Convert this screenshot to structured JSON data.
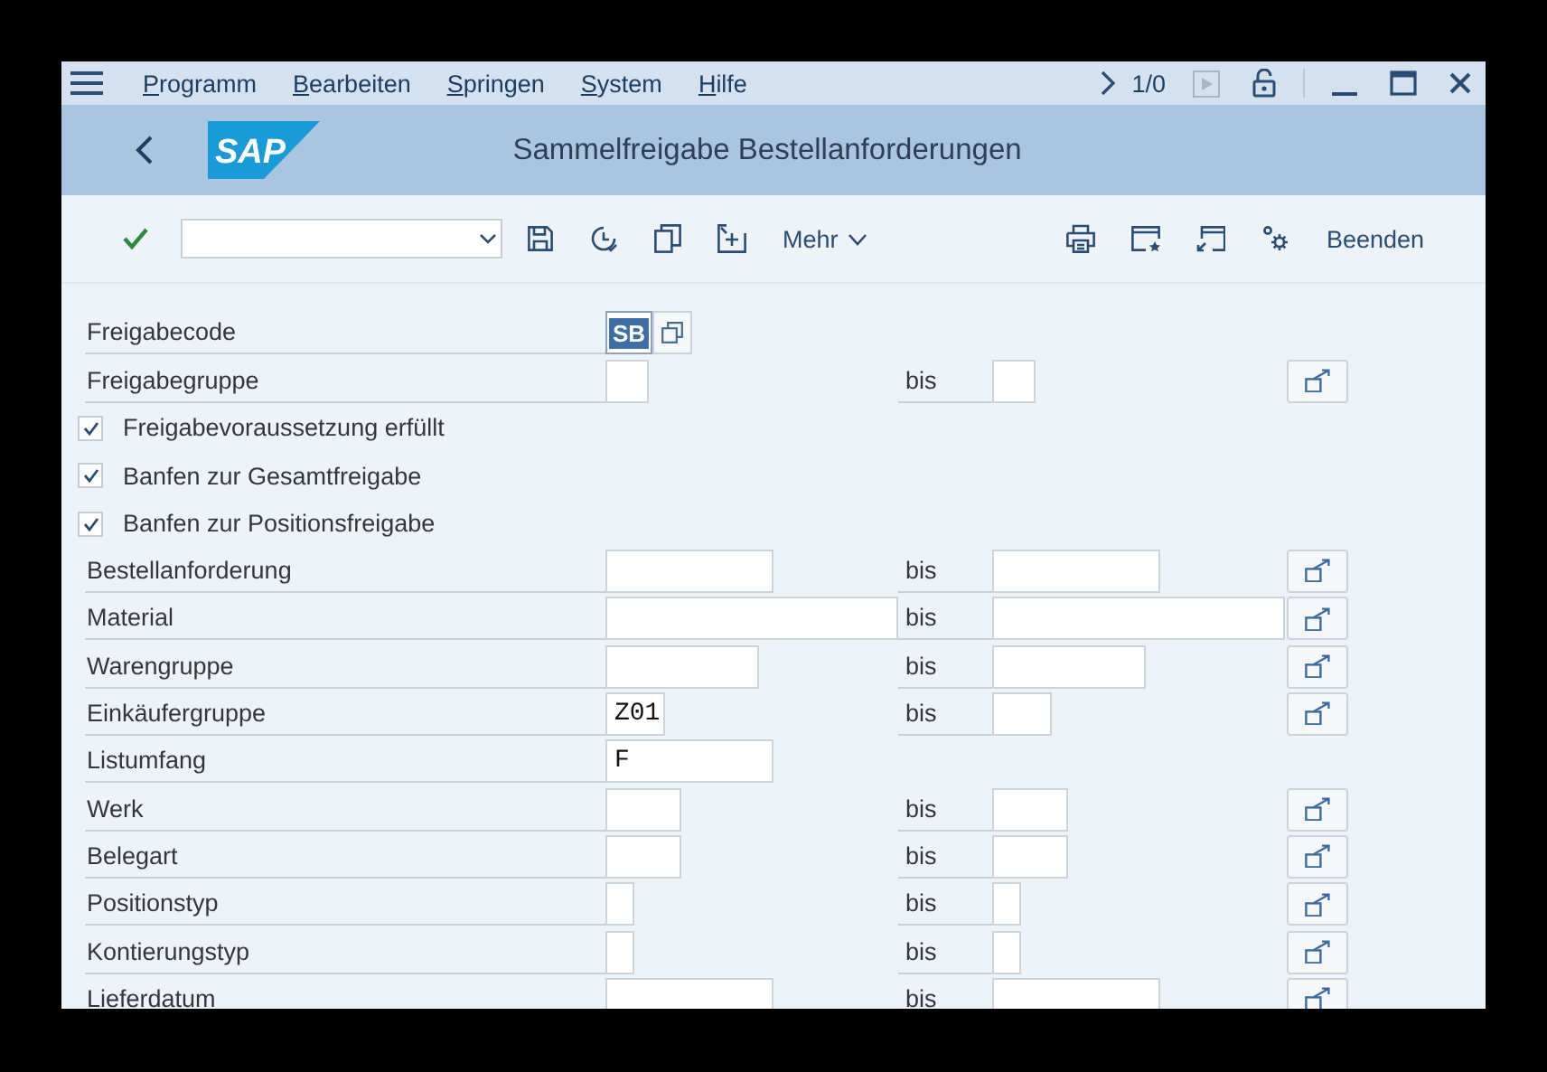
{
  "menu_bar": {
    "items": [
      "Programm",
      "Bearbeiten",
      "Springen",
      "System",
      "Hilfe"
    ],
    "page_counter": "1/0"
  },
  "title_bar": {
    "logo": "SAP",
    "title": "Sammelfreigabe Bestellanforderungen"
  },
  "toolbar": {
    "more_label": "Mehr",
    "exit_label": "Beenden"
  },
  "rows": [
    {
      "kind": "code",
      "label": "Freigabecode",
      "value": "SB",
      "focused": true
    },
    {
      "kind": "range",
      "label": "Freigabegruppe",
      "to_label": "bis"
    },
    {
      "kind": "checkbox",
      "label": "Freigabevoraussetzung erfüllt",
      "checked": true
    },
    {
      "kind": "checkbox",
      "label": "Banfen zur Gesamtfreigabe",
      "checked": true
    },
    {
      "kind": "checkbox",
      "label": "Banfen zur Positionsfreigabe",
      "checked": true
    },
    {
      "kind": "range",
      "label": "Bestellanforderung",
      "to_label": "bis"
    },
    {
      "kind": "range",
      "label": "Material",
      "to_label": "bis"
    },
    {
      "kind": "range",
      "label": "Warengruppe",
      "to_label": "bis"
    },
    {
      "kind": "range",
      "label": "Einkäufergruppe",
      "value": "Z01",
      "to_label": "bis"
    },
    {
      "kind": "single",
      "label": "Listumfang",
      "value": "F"
    },
    {
      "kind": "range",
      "label": "Werk",
      "to_label": "bis"
    },
    {
      "kind": "range",
      "label": "Belegart",
      "to_label": "bis"
    },
    {
      "kind": "range",
      "label": "Positionstyp",
      "to_label": "bis"
    },
    {
      "kind": "range",
      "label": "Kontierungstyp",
      "to_label": "bis"
    },
    {
      "kind": "range",
      "label": "Lieferdatum",
      "to_label": "bis"
    }
  ]
}
